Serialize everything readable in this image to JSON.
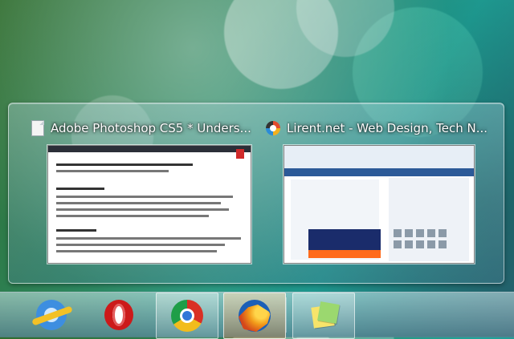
{
  "taskbar_preview": {
    "windows": [
      {
        "title": "Adobe Photoshop CS5 * Unders...",
        "icon": "document-icon"
      },
      {
        "title": "Lirent.net - Web Design, Tech N...",
        "icon": "lirent-icon"
      }
    ]
  },
  "taskbar": {
    "items": [
      {
        "icon": "internet-explorer-icon"
      },
      {
        "icon": "opera-icon"
      },
      {
        "icon": "chrome-icon"
      },
      {
        "icon": "firefox-icon"
      },
      {
        "icon": "sticky-notes-icon"
      }
    ]
  }
}
